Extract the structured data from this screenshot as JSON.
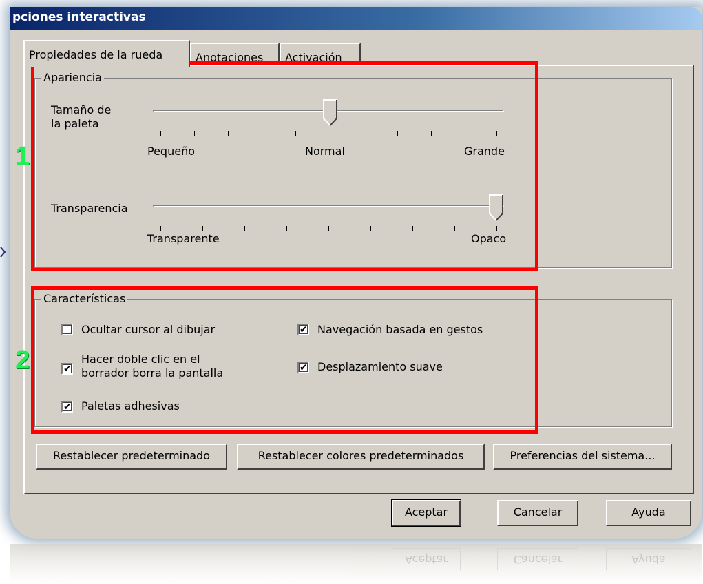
{
  "window": {
    "title": "pciones interactivas"
  },
  "tabs": [
    {
      "label": "Propiedades de la rueda",
      "active": true
    },
    {
      "label": "Anotaciones",
      "active": false
    },
    {
      "label": "Activación",
      "active": false
    }
  ],
  "appearance": {
    "legend": "Apariencia",
    "size_label_line1": "Tamaño de",
    "size_label_line2": "la paleta",
    "size_min": "Pequeño",
    "size_mid": "Normal",
    "size_max": "Grande",
    "size_value": 0.5,
    "transparency_label": "Transparencia",
    "transparency_min": "Transparente",
    "transparency_max": "Opaco",
    "transparency_value": 1.0
  },
  "features": {
    "legend": "Características",
    "options": [
      {
        "label": "Ocultar cursor al dibujar",
        "checked": false
      },
      {
        "label_line1": "Hacer doble clic en el",
        "label_line2": "borrador borra la pantalla",
        "checked": true
      },
      {
        "label": "Paletas adhesivas",
        "checked": true
      },
      {
        "label": "Navegación basada en gestos",
        "checked": true
      },
      {
        "label": "Desplazamiento suave",
        "checked": true
      }
    ]
  },
  "panel_buttons": {
    "reset_default": "Restablecer predeterminado",
    "reset_colors": "Restablecer colores predeterminados",
    "system_prefs": "Preferencias del sistema..."
  },
  "dialog_buttons": {
    "ok": "Aceptar",
    "cancel": "Cancelar",
    "help": "Ayuda"
  },
  "callouts": {
    "first": "1",
    "second": "2"
  },
  "colors": {
    "highlight_box": "#ff0000",
    "callout_number": "#22ee55",
    "titlebar_start": "#0a246a",
    "titlebar_end": "#a6caf0",
    "dialog_face": "#d4d0c8"
  }
}
